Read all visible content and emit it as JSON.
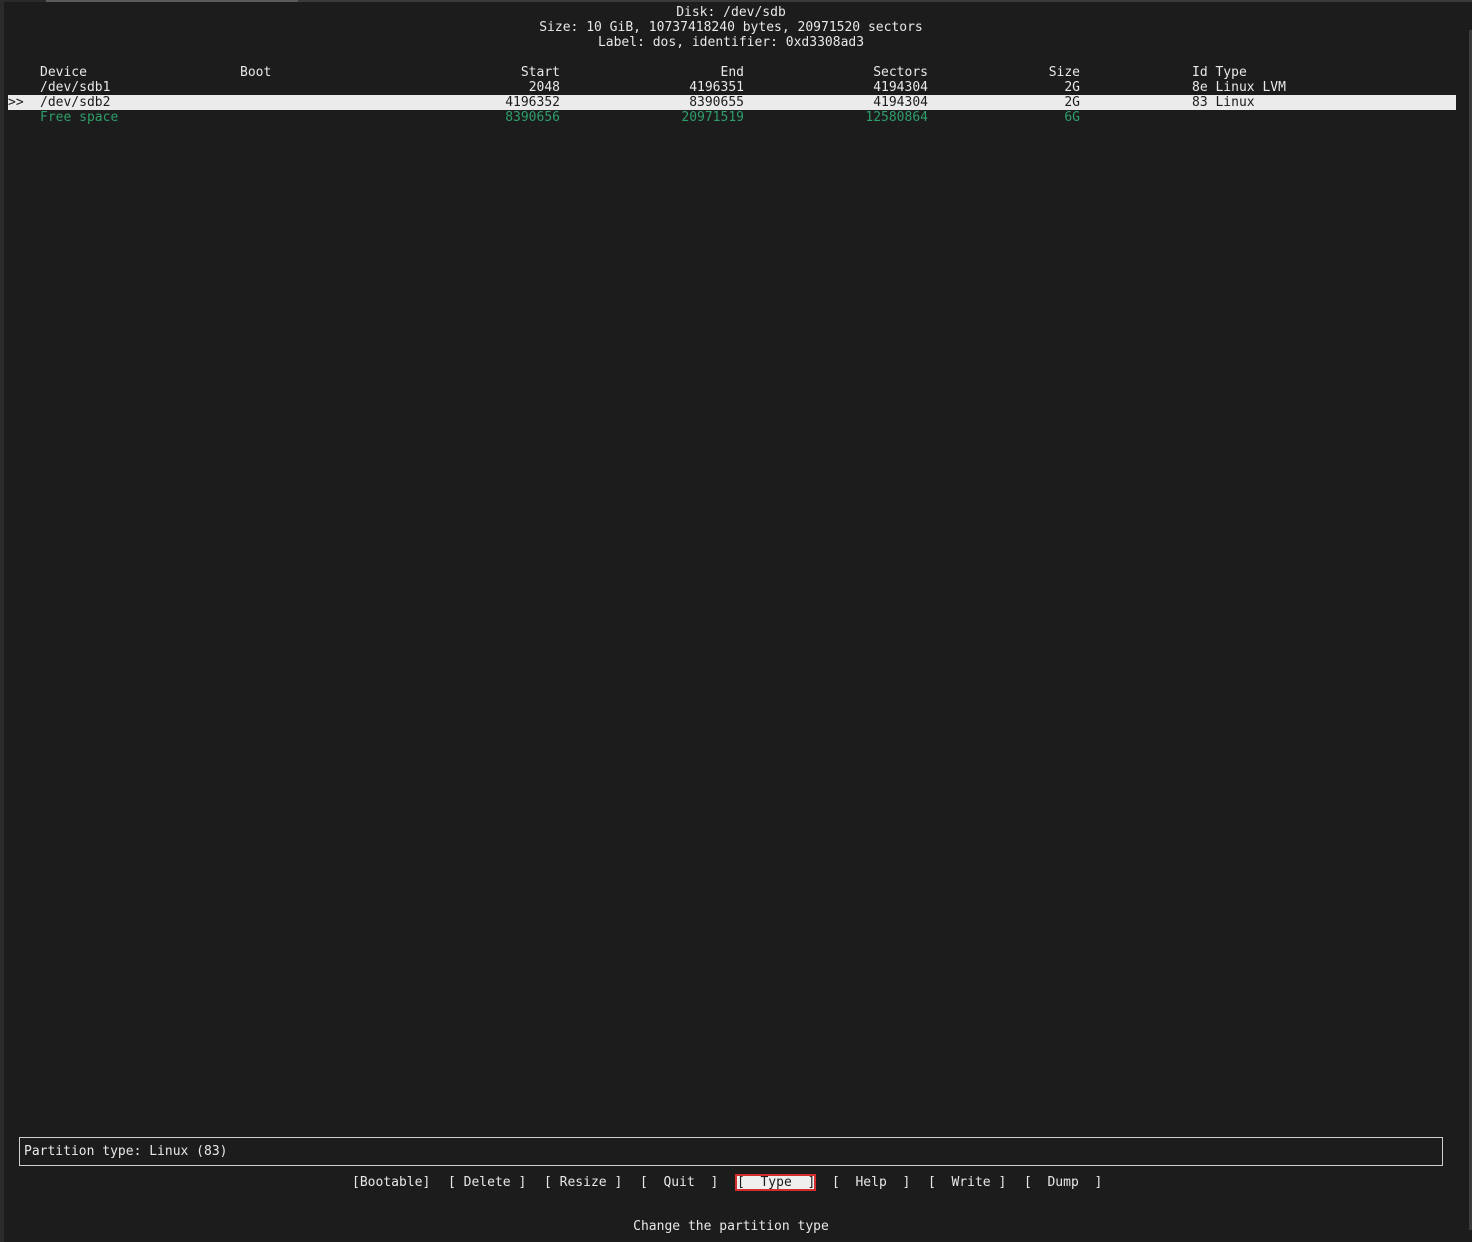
{
  "header": {
    "disk": "Disk: /dev/sdb",
    "size": "Size: 10 GiB, 10737418240 bytes, 20971520 sectors",
    "label": "Label: dos, identifier: 0xd3308ad3"
  },
  "table": {
    "columns": {
      "device": "Device",
      "boot": "Boot",
      "start": "Start",
      "end": "End",
      "sectors": "Sectors",
      "size": "Size",
      "type": "Id Type"
    },
    "rows": [
      {
        "marker": "",
        "device": "/dev/sdb1",
        "boot": "",
        "start": "2048",
        "end": "4196351",
        "sectors": "4194304",
        "size": "2G",
        "type": "8e Linux LVM"
      },
      {
        "marker": ">>",
        "device": "/dev/sdb2",
        "boot": "",
        "start": "4196352",
        "end": "8390655",
        "sectors": "4194304",
        "size": "2G",
        "type": "83 Linux"
      },
      {
        "marker": "",
        "device": "Free space",
        "boot": "",
        "start": "8390656",
        "end": "20971519",
        "sectors": "12580864",
        "size": "6G",
        "type": ""
      }
    ]
  },
  "status": {
    "text": "Partition type: Linux (83)"
  },
  "menu": [
    {
      "label": "[Bootable]"
    },
    {
      "label": "[ Delete ]"
    },
    {
      "label": "[ Resize ]"
    },
    {
      "label": "[  Quit  ]"
    },
    {
      "label": "[  Type  ]"
    },
    {
      "label": "[  Help  ]"
    },
    {
      "label": "[  Write ]"
    },
    {
      "label": "[  Dump  ]"
    }
  ],
  "hint": "Change the partition type",
  "colors": {
    "background": "#1c1c1c",
    "foreground": "#e8e8e8",
    "selected_row": "#ebebeb",
    "free_space": "#2e9e6a",
    "active_menu_border": "#d42d2d"
  }
}
